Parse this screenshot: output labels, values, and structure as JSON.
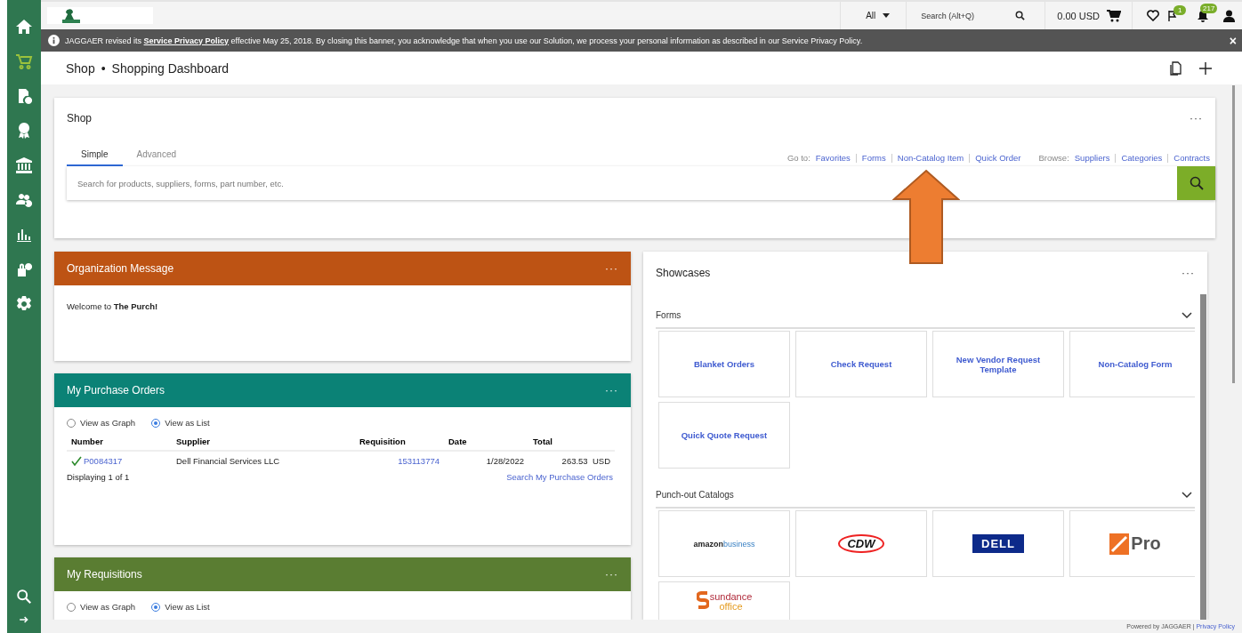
{
  "sidebar": {
    "items": [
      {
        "kind": "home",
        "selected": false
      },
      {
        "kind": "cart",
        "selected": true
      },
      {
        "kind": "doc",
        "selected": false
      },
      {
        "kind": "award",
        "selected": false
      },
      {
        "kind": "bank",
        "selected": false
      },
      {
        "kind": "people",
        "selected": false
      },
      {
        "kind": "chart",
        "selected": false
      },
      {
        "kind": "lockgear",
        "selected": false
      },
      {
        "kind": "gear",
        "selected": false
      }
    ],
    "bottom": [
      {
        "kind": "search"
      },
      {
        "kind": "arrow"
      }
    ]
  },
  "topbar": {
    "scope": "All",
    "search_placeholder": "Search (Alt+Q)",
    "cart_total": "0.00 USD",
    "flag_badge": "1",
    "bell_badge": "217"
  },
  "banner": {
    "before": "JAGGAER revised its ",
    "link": "Service Privacy Policy",
    "after": " effective May 25, 2018. By closing this banner, you acknowledge that when you use our Solution, we process your personal information as described in our Service Privacy Policy.",
    "close": "×"
  },
  "breadcrumb": [
    "Shop",
    "Shopping Dashboard"
  ],
  "breadcrumb_separator": "•",
  "shop": {
    "title": "Shop",
    "menu": "···",
    "tabs": [
      {
        "label": "Simple",
        "selected": true
      },
      {
        "label": "Advanced",
        "selected": false
      }
    ],
    "goto_label": "Go to:",
    "goto_links": [
      "Favorites",
      "Forms",
      "Non-Catalog Item",
      "Quick Order"
    ],
    "browse_label": "Browse:",
    "browse_links": [
      "Suppliers",
      "Categories",
      "Contracts"
    ],
    "search_placeholder": "Search for products, suppliers, forms, part number, etc."
  },
  "org_message": {
    "title": "Organization Message",
    "menu": "···",
    "text": "Welcome to **The Purch!**",
    "color": "#bd5314"
  },
  "purchase_orders": {
    "title": "My Purchase Orders",
    "menu": "···",
    "color": "#0b8276",
    "views": [
      {
        "label": "View as Graph",
        "selected": false
      },
      {
        "label": "View as List",
        "selected": true
      }
    ],
    "columns": [
      "Number",
      "Supplier",
      "Requisition",
      "Date",
      "Total"
    ],
    "rows": [
      {
        "number": "P0084317",
        "approved": true,
        "supplier": "Dell Financial Services LLC",
        "requisition": "153113774",
        "date": "1/28/2022",
        "total": "263.53",
        "currency": "USD"
      }
    ],
    "count": "Displaying 1 of 1",
    "search_link": "Search My Purchase Orders"
  },
  "requisitions": {
    "title": "My Requisitions",
    "menu": "···",
    "color": "#5a7d32",
    "views": [
      {
        "label": "View as Graph",
        "selected": false
      },
      {
        "label": "View as List",
        "selected": true
      }
    ]
  },
  "showcases": {
    "title": "Showcases",
    "menu": "···",
    "sections": [
      {
        "title": "Forms",
        "expanded": true,
        "tiles": [
          {
            "kind": "form",
            "parts": [
              "Blanket Orders"
            ]
          },
          {
            "kind": "form",
            "parts": [
              "Check Request"
            ]
          },
          {
            "kind": "form",
            "parts": [
              "New Vendor Request Template"
            ]
          },
          {
            "kind": "form",
            "parts": [
              "Non-Catalog Form"
            ]
          },
          {
            "kind": "form",
            "parts": [
              "Quick Quote Request"
            ]
          }
        ]
      },
      {
        "title": "Punch-out Catalogs",
        "expanded": true,
        "tiles": [
          {
            "kind": "amazon",
            "parts": [
              "amazon",
              "business"
            ]
          },
          {
            "kind": "cdw",
            "parts": [
              "CDW"
            ]
          },
          {
            "kind": "dell",
            "parts": [
              "DELL"
            ]
          },
          {
            "kind": "homedepot",
            "parts": [
              "Pro"
            ]
          },
          {
            "kind": "sundance",
            "parts": [
              "sundance",
              "office"
            ]
          }
        ]
      }
    ]
  },
  "footer": {
    "text": "Powered by JAGGAER |",
    "link": "Privacy Policy"
  }
}
